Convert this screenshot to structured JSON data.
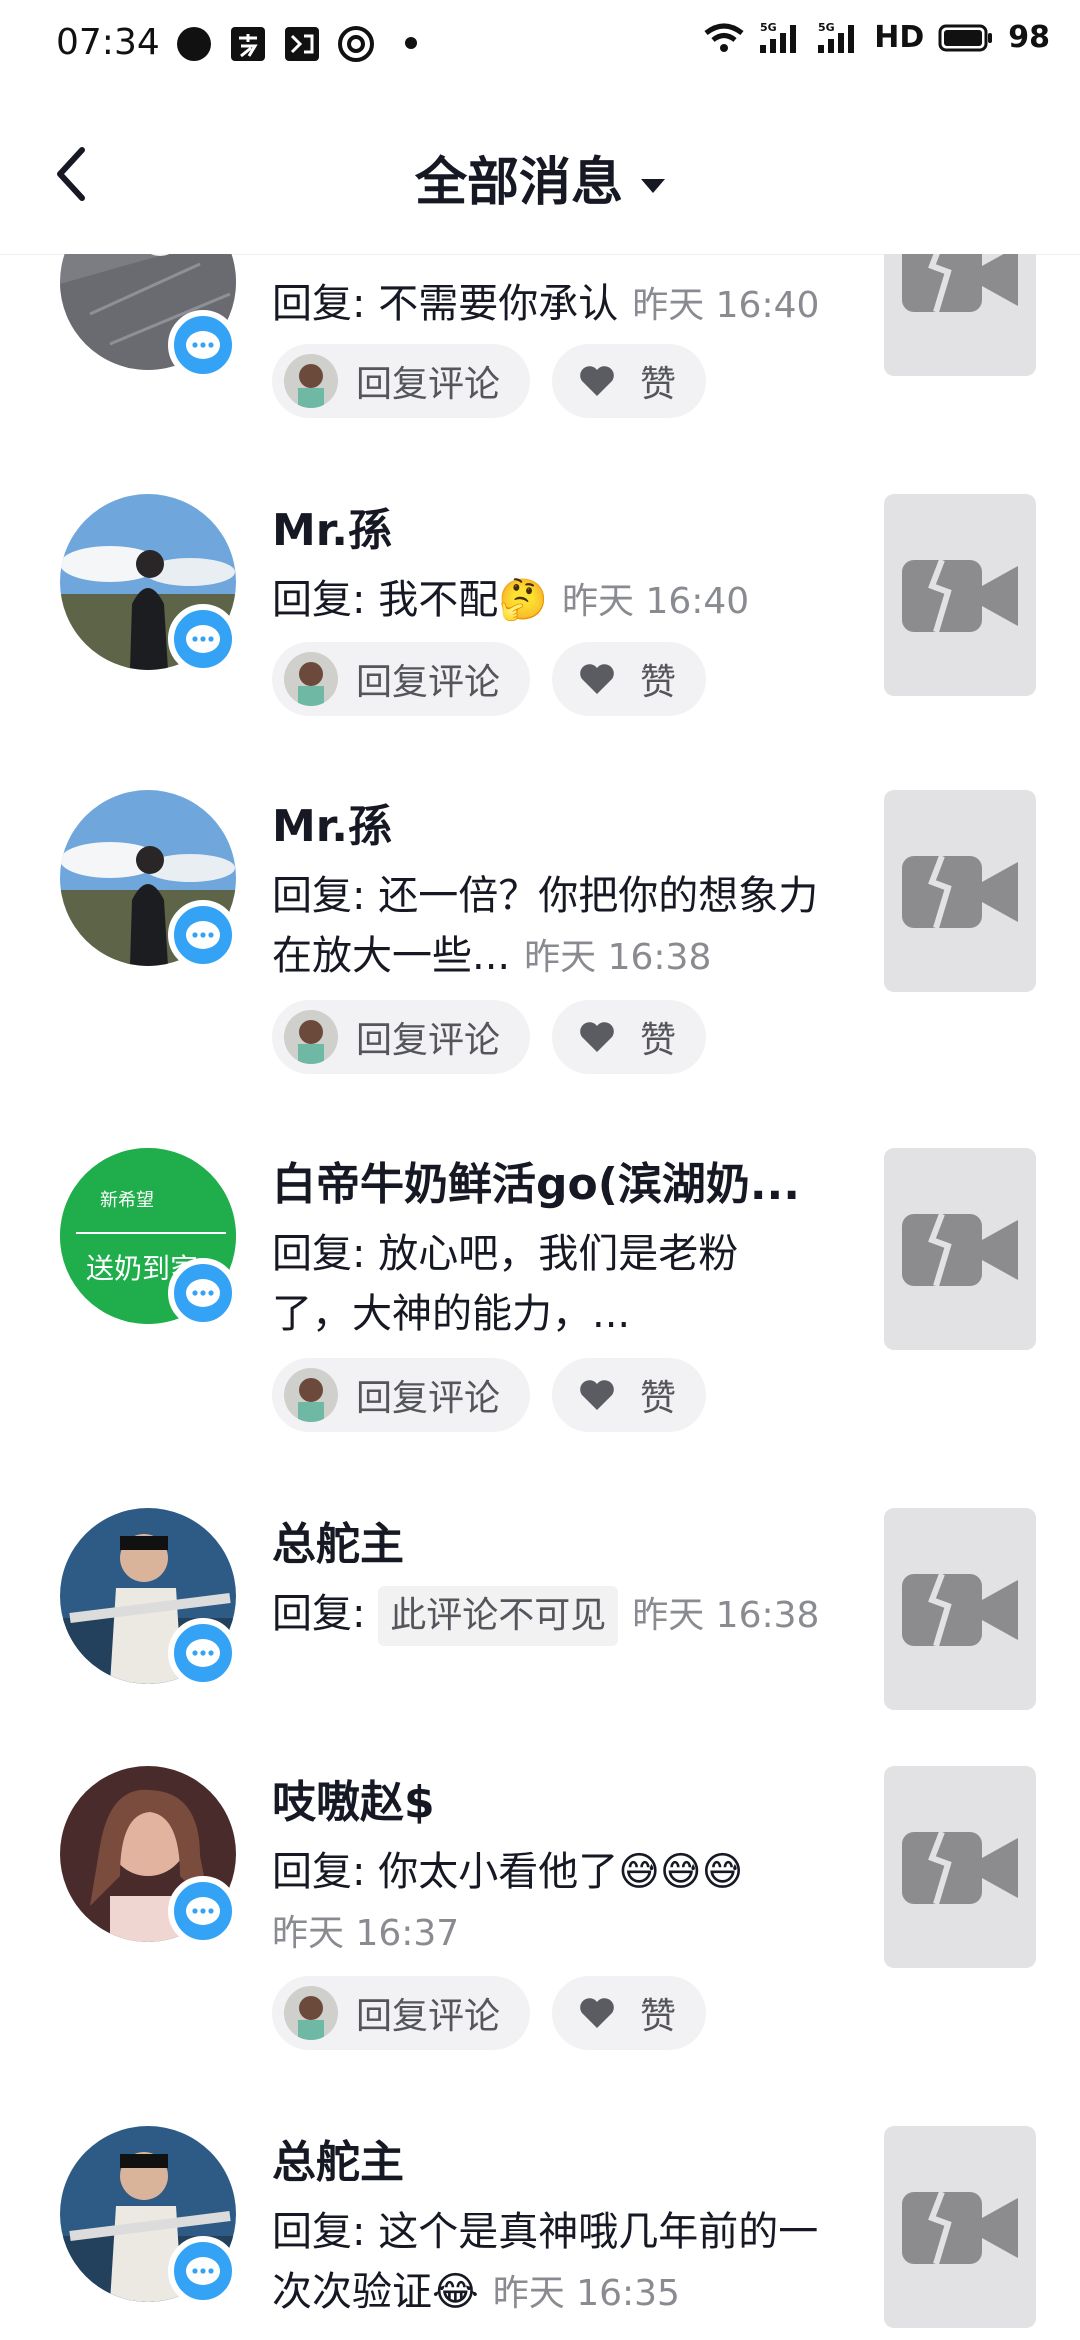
{
  "status": {
    "time": "07:34",
    "battery": "98",
    "hd_label": "HD"
  },
  "header": {
    "title": "全部消息"
  },
  "actions": {
    "reply_label": "回复评论",
    "like_label": "赞"
  },
  "messages": [
    {
      "name": "",
      "reply": "回复: 不需要你承认",
      "time": "昨天 16:40"
    },
    {
      "name": "Mr.孫",
      "reply": "回复: 我不配",
      "emoji": "🤔",
      "time": "昨天 16:40"
    },
    {
      "name": "Mr.孫",
      "reply": "回复: 还一倍？你把你的想象力在放大一些...",
      "time": "昨天 16:38"
    },
    {
      "name": "白帝牛奶鲜活go(滨湖奶...",
      "reply": "回复: 放心吧，我们是老粉了，大神的能力，...",
      "avatar_text": "送奶到家",
      "avatar_brand": "新希望",
      "time": ""
    },
    {
      "name": "总舵主",
      "reply_prefix": "回复:",
      "hidden_text": "此评论不可见",
      "time": "昨天 16:38"
    },
    {
      "name": "吱嗷赵$",
      "reply": "回复: 你太小看他了",
      "emoji": "😅😅😅",
      "time": "昨天 16:37"
    },
    {
      "name": "总舵主",
      "reply": "回复: 这个是真神哦几年前的一次次验证",
      "emoji": "😂",
      "time": "昨天 16:35"
    }
  ],
  "colors": {
    "badge": "#35a3f5",
    "pill_bg": "#f2f2f4",
    "thumb_bg": "#e2e2e4",
    "time": "#8a8b91"
  }
}
